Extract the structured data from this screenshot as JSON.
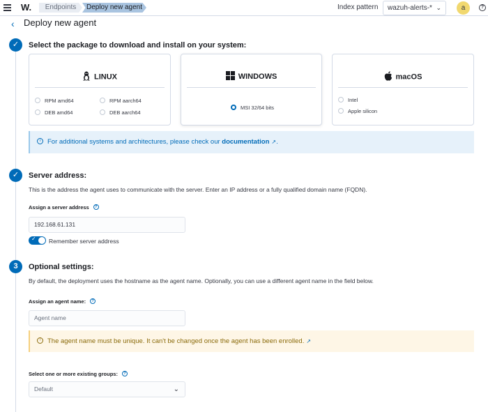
{
  "header": {
    "logo": "W.",
    "breadcrumbs": [
      "Endpoints",
      "Deploy new agent"
    ],
    "index_pattern_label": "Index pattern",
    "index_pattern_value": "wazuh-alerts-*",
    "avatar_initial": "a"
  },
  "page": {
    "title": "Deploy new agent"
  },
  "step1": {
    "title": "Select the package to download and install on your system:",
    "os_cards": [
      {
        "name": "LINUX",
        "options": [
          "RPM amd64",
          "RPM aarch64",
          "DEB amd64",
          "DEB aarch64"
        ]
      },
      {
        "name": "WINDOWS",
        "options": [
          "MSI 32/64 bits"
        ],
        "selected": "MSI 32/64 bits"
      },
      {
        "name": "macOS",
        "options": [
          "Intel",
          "Apple silicon"
        ]
      }
    ],
    "callout_text": "For additional systems and architectures, please check our",
    "callout_link": "documentation",
    "callout_end": "."
  },
  "step2": {
    "title": "Server address:",
    "description": "This is the address the agent uses to communicate with the server. Enter an IP address or a fully qualified domain name (FQDN).",
    "field_label": "Assign a server address",
    "field_value": "192.168.61.131",
    "toggle_label": "Remember server address",
    "toggle_on": true
  },
  "step3": {
    "number": "3",
    "title": "Optional settings:",
    "description": "By default, the deployment uses the hostname as the agent name. Optionally, you can use a different agent name in the field below.",
    "name_label": "Assign an agent name:",
    "name_placeholder": "Agent name",
    "warning": "The agent name must be unique. It can't be changed once the agent has been enrolled.",
    "groups_label": "Select one or more existing groups:",
    "groups_value": "Default"
  },
  "colors": {
    "accent": "#006bb8",
    "avatar": "#f1d86f",
    "info_bg": "#e6f1fa",
    "warn_bg": "#fef6e6"
  }
}
